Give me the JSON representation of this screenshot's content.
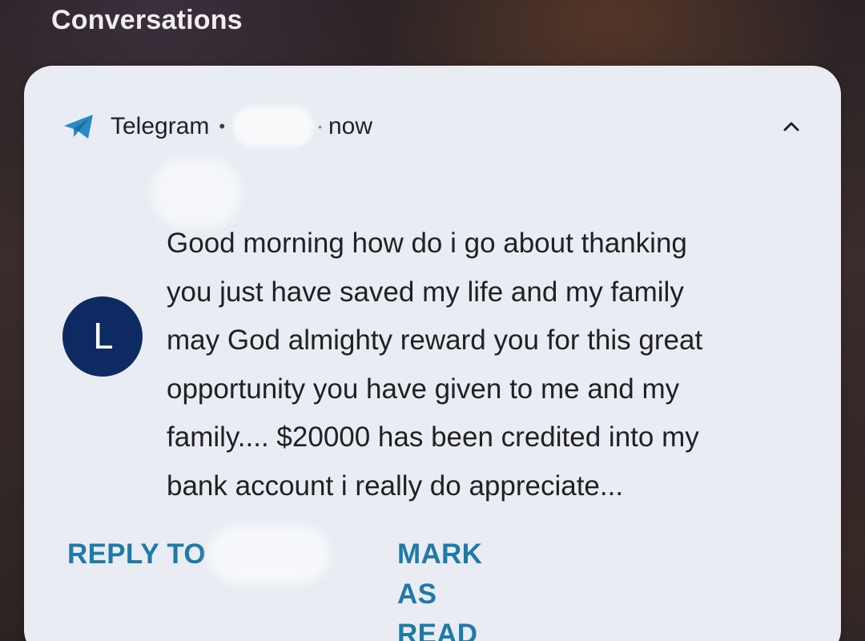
{
  "section_header": "Conversations",
  "notification": {
    "app_name": "Telegram",
    "separator": "•",
    "time": "now",
    "app_icon": "telegram-paper-plane-icon",
    "expand_icon": "chevron-up-icon",
    "avatar_initial": "L",
    "avatar_color": "#0e2a63",
    "message": "Good morning how do i go about thanking\nyou just have saved my life and my family\nmay God almighty reward you for this great\nopportunity you have given to me and my\nfamily.... $20000 has been credited into my\nbank account i really do appreciate...",
    "actions": {
      "reply_label": "REPLY TO",
      "mark_read_label": "MARK AS READ"
    },
    "accent_color": "#1f7aa8",
    "telegram_color": "#2a8bc4"
  }
}
